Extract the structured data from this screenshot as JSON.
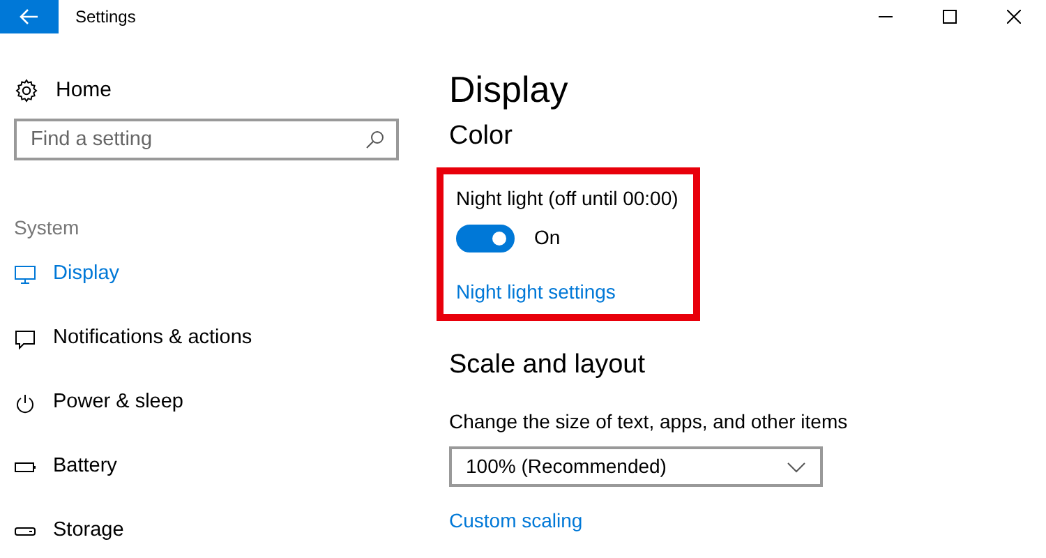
{
  "window": {
    "title": "Settings"
  },
  "sidebar": {
    "home": "Home",
    "search": {
      "placeholder": "Find a setting"
    },
    "section": "System",
    "items": [
      {
        "label": "Display",
        "kind": "monitor",
        "selected": true
      },
      {
        "label": "Notifications & actions",
        "kind": "message",
        "selected": false
      },
      {
        "label": "Power & sleep",
        "kind": "power",
        "selected": false
      },
      {
        "label": "Battery",
        "kind": "battery",
        "selected": false
      },
      {
        "label": "Storage",
        "kind": "drive",
        "selected": false
      }
    ]
  },
  "content": {
    "title": "Display",
    "color": {
      "heading": "Color",
      "night_light": {
        "label": "Night light (off until 00:00)",
        "on": true,
        "state_text": "On",
        "link": "Night light settings",
        "highlighted": true
      }
    },
    "scale": {
      "heading": "Scale and layout",
      "description": "Change the size of text, apps, and other items",
      "dropdown": "100% (Recommended)",
      "link": "Custom scaling"
    }
  }
}
